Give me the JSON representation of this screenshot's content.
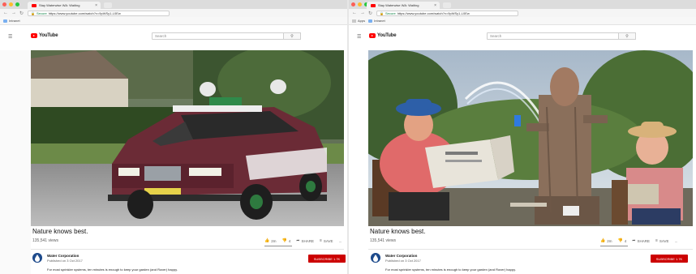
{
  "colors": {
    "youtube_red": "#ff0000",
    "subscribe_red": "#cc0000",
    "chrome_tabbar": "#dcdcdc",
    "text_dark": "#111111",
    "text_muted": "#606060"
  },
  "icons": {
    "hamburger": "menu-icon",
    "search": "search-icon",
    "like": "thumb-up-icon",
    "dislike": "thumb-down-icon",
    "share": "share-icon",
    "save": "playlist-add-icon",
    "more": "more-icon"
  },
  "left": {
    "browser": {
      "tab_title": "Stay Waterwise WA: Waiting",
      "tab_close": "×",
      "secure_label": "Secure",
      "url": "https://www.youtube.com/watch?v=9pWSy1-L0Ew",
      "bookmarks": [
        {
          "label": "Intranet"
        }
      ]
    },
    "youtube": {
      "logo_text": "YouTube",
      "search_placeholder": "Search"
    },
    "video": {
      "title": "Nature knows best.",
      "views": "135,541 views"
    },
    "actions": {
      "like": "2m",
      "dislike": "4",
      "share": "SHARE",
      "save": "SAVE",
      "more": "..."
    },
    "channel": {
      "name": "Water Corporation",
      "published": "Published on 3 Oct 2017",
      "subscribe": "SUBSCRIBE 1.7K"
    },
    "description": "For most sprinkler systems, ten minutes is enough to keep your garden (and Rover) happy."
  },
  "right": {
    "browser": {
      "tab_title": "Stay Waterwise WA: Waiting",
      "tab_close": "×",
      "secure_label": "Secure",
      "url": "https://www.youtube.com/watch?v=9pWSy1-L0Ew",
      "bookmarks": [
        {
          "label": "Apps"
        },
        {
          "label": "Intranet"
        }
      ]
    },
    "youtube": {
      "logo_text": "YouTube",
      "search_placeholder": "Search"
    },
    "video": {
      "title": "Nature knows best.",
      "views": "135,541 views"
    },
    "actions": {
      "like": "2m",
      "dislike": "4",
      "share": "SHARE",
      "save": "SAVE",
      "more": "..."
    },
    "channel": {
      "name": "Water Corporation",
      "published": "Published on 3 Oct 2017",
      "subscribe": "SUBSCRIBE 1.7K"
    },
    "description": "For most sprinkler systems, ten minutes is enough to keep your garden (and Rover) happy."
  }
}
